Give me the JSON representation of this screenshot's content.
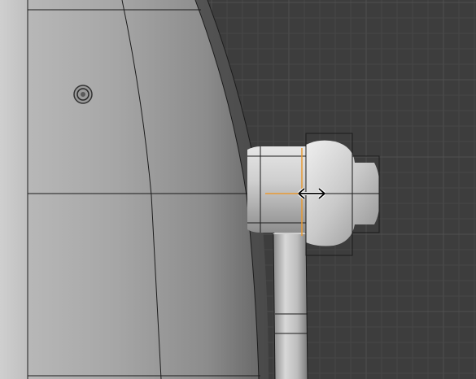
{
  "viewport": {
    "background_color": "#3d3d3d",
    "grid_minor_color": "#474747",
    "grid_major_color": "#505050",
    "mesh_light_color": "#c4c4c4",
    "mesh_dark_color": "#4a4a4a",
    "edge_color": "#1c1c1c",
    "selected_edge_color": "#e89a33"
  },
  "cursor": {
    "icon": "horizontal-resize-arrow-icon"
  },
  "pivot": {
    "icon": "origin-pivot-icon"
  }
}
